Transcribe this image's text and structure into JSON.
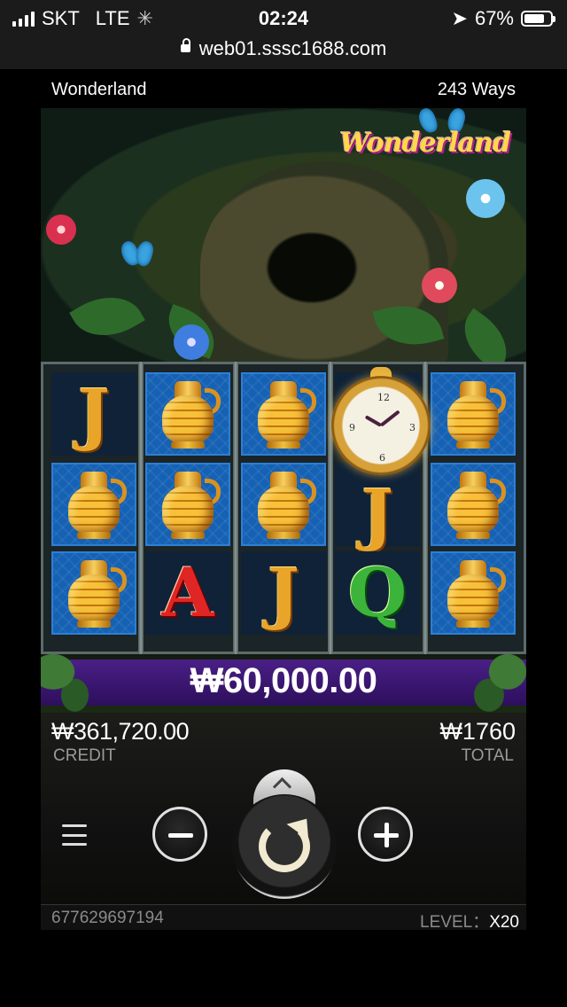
{
  "status_bar": {
    "carrier": "SKT",
    "network": "LTE",
    "time": "02:24",
    "battery": "67%",
    "battery_level": 0.67
  },
  "browser": {
    "url": "web01.sssc1688.com"
  },
  "game": {
    "name": "Wonderland",
    "ways": "243 Ways",
    "logo_text": "Wonderland"
  },
  "reels": {
    "symbols": [
      [
        "J",
        "vase",
        "vase",
        "clock",
        "vase"
      ],
      [
        "vase",
        "vase",
        "vase",
        "J",
        "vase"
      ],
      [
        "vase",
        "A",
        "J",
        "Q",
        "vase"
      ]
    ]
  },
  "win": {
    "amount": "₩60,000.00"
  },
  "balance": {
    "credit_value": "₩361,720.00",
    "credit_label": "CREDIT",
    "total_value": "₩1760",
    "total_label": "TOTAL"
  },
  "footer": {
    "id": "677629697194",
    "level_label": "LEVEL：",
    "level_value": "X20"
  },
  "icons": {
    "menu": "menu-icon",
    "minus": "minus-icon",
    "plus": "plus-icon",
    "spin": "spin-icon",
    "expand": "chevron-up-icon",
    "lock": "lock-icon"
  },
  "colors": {
    "win_plate": "#4a1f86",
    "reel_blue": "#1561b4",
    "gold": "#e9a52a"
  }
}
